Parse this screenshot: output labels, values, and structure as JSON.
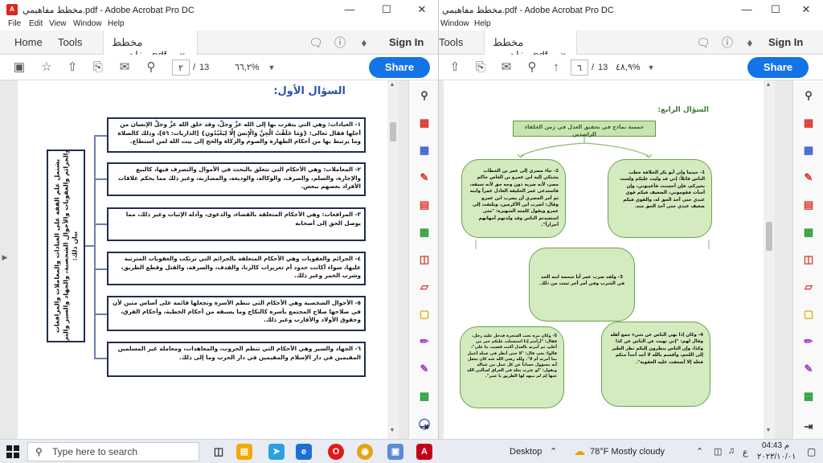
{
  "left_window": {
    "title": "مخطط مفاهيمي.pdf - Adobe Acrobat Pro DC",
    "menu": [
      "File",
      "Edit",
      "View",
      "Window",
      "Help"
    ],
    "tabs": {
      "home": "Home",
      "tools": "Tools",
      "doc": "مخطط مفاهيمي.pdf",
      "close": "×"
    },
    "sign_in": "Sign In",
    "page_current": "٢",
    "page_sep": "/",
    "page_total": "13",
    "zoom": "٦٦,٢%",
    "share": "Share",
    "heading": "السؤال الأول:",
    "side_box": "يشتمل علم الفقه على العبادات والمعاملات والمرافعات والجرائم والعقوبات والأحوال الشخصية، والجهاد والسير والتي بيان ذلك:",
    "boxes": [
      "١- العبادات: وهي التي يتقرب بها إلى الله عزَّ وجلَّ، وقد خلق الله عزَّ وجلَّ الإنسان من أجلها فقال تعالى: {وَمَا خَلَقْتُ الْجِنَّ وَالْإِنسَ إِلَّا لِيَعْبُدُونِ} [الذاريات: ٥٦]، وذلك كالصلاة وما يرتبط بها من أحكام الطهارة والصوم والزكاة والحج إلى بيت الله لمن استطاع.",
      "٢- المعاملات: وهي الأحكام التي تتعلق بالبحث في الأموال والتصرف فيها، كالبيع والإجارة، والسلم، والصرف، والوكالة، والوديعة، والمضاربة، وغير ذلك مما يحكم علاقات الأفراد بعضهم ببعض.",
      "٣- المرافعات: وهي الأحكام المتعلقة بالقضاء، والدعوى، وأدلة الإثبات وغير ذلك، مما يوصل الحق إلى أصحابه",
      "٤- الجرائم والعقوبات وهي الأحكام المتعلقة بالجرائم التي ترتكب والعقوبات المترتبة عليها، سواء أكانت حدود أم تعزيرات كالزنا، والقذف، والسرقة، والقتل وقطع الطريق، وشرب الخمر وغير ذلك.",
      "٥- الأحوال الشخصية وهي الأحكام التي تنظم الأسرة وتجعلها قائمة على أساس متين لأن في صلاحها صلاح المجتمع بأسره كالنكاح وما يسبقه من أحكام الخطبة، وأحكام الفرق، وحقوق الأولاد والأقارب وغير ذلك.",
      "٦- الجهاد والسير وهي الأحكام التي تنظم الحروب، والمعاهدات، ومعاملة غير المسلمين المقيمين في دار الإسلام والمقيمين في دار الحرب وما إلى ذلك."
    ]
  },
  "right_window": {
    "title": "مخطط مفاهيمي.pdf - Adobe Acrobat Pro DC",
    "menu": [
      "Window",
      "Help"
    ],
    "tabs": {
      "tools": "Tools",
      "doc": "مخطط مفاهيمي.pdf",
      "close": "×"
    },
    "sign_in": "Sign In",
    "page_current": "٦",
    "page_sep": "/",
    "page_total": "13",
    "zoom": "٤٨,٩%",
    "share": "Share",
    "heading": "السؤال الرابع:",
    "top_box": "خمسة نماذج في تحقيق العدل في زمن الخلفاء الراشدين",
    "ovals": [
      "1- حينما ولي أبو بكر الخلافة خطب الناس قائلاً: إني قد وليت عليكم ولست بخيركم، فإن أحسنت فأعينوني، وإن أسأت فقوموني، الضعيف فيكم قوي عندي حتى آخذ الحق له، والقوي فيكم ضعيف عندي حتى آخذ الحق منه.",
      "2- جاء مصري إلى عمر بن الخطاب يشتكي إليه ابن عمرو بن العاص حاكم مصر، لأنه ضربه دون وجه حق لأنه سبقه، فاستدعى عمر الخليفة العادل عمراً وابنه ثم أمر المصري أن يضرب ابن عمرو وقال: اضرب ابن الأكرمين، ويلتفت إلى عمرو ويقول كلمته الشهيرة: \"متى استعبدتم الناس وقد ولدتهم أمهاتهم أحراراً\".",
      "3- ولقد ضرب عمر أبا شحمة ابنه الحد في الشرب وفي أمر آخر ثبتت من ذلك.",
      "4- وكان إذا نهى الناس عن شيء جمع أهله وقال لهم: \"إني نهيت عن الناس عن كذا وكذا، وإن الناس ينظرون إليكم نظر الطير إلى اللحم، وأقسم بالله لا أجد أحداً منكم فعله إلا أضعفت عليه العقوبة\".",
      "5- وكان مرة تحت الشجرة فدخل عليه رجل، فقال: \"أرأيتم إذا استعملت عليكم خير من أعلم، ثم أمرته بالعدل أكنت قضيت ما علي\"، قالوا: نعم، قال: \"لا حتى أنظر في عمله أعمل بما أمرته أم لا\". ولله رضي الله عنه كان يجعل أنه مسؤول حساباً عن كل عمل من عماله ويقول: \"لو عثرت بغلة في العراق لسألني الله عنها لِمَ لم تمهد لها الطريق يا عمر\"."
    ]
  },
  "taskbar": {
    "search_placeholder": "Type here to search",
    "desktop": "Desktop",
    "weather": "78°F  Mostly cloudy",
    "time": "04:43 م",
    "date": "٢٠٢٣/١٠/٠١",
    "lang": "ع"
  }
}
